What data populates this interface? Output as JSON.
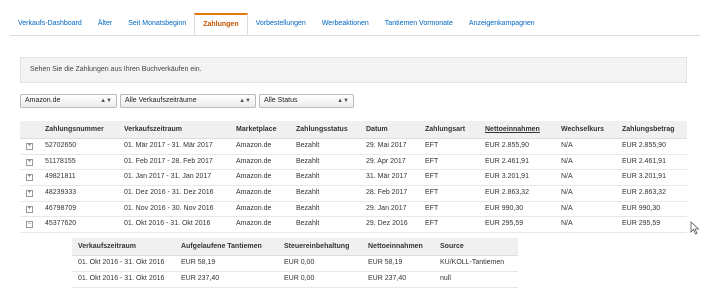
{
  "tabs": [
    {
      "label": "Verkaufs-Dashboard",
      "active": false
    },
    {
      "label": "Älter",
      "active": false
    },
    {
      "label": "Seit Monatsbeginn",
      "active": false
    },
    {
      "label": "Zahlungen",
      "active": true
    },
    {
      "label": "Vorbestellungen",
      "active": false
    },
    {
      "label": "Werbeaktionen",
      "active": false
    },
    {
      "label": "Tantiemen Vormonate",
      "active": false
    },
    {
      "label": "Anzeigenkampagnen",
      "active": false
    }
  ],
  "info_text": "Sehen Sie die Zahlungen aus Ihren Buchverkäufen ein.",
  "filters": {
    "marketplace": "Amazon.de",
    "period": "Alle Verkaufszeiträume",
    "status": "Alle Status"
  },
  "table": {
    "headers": [
      "Zahlungsnummer",
      "Verkaufszeitraum",
      "Marketplace",
      "Zahlungsstatus",
      "Datum",
      "Zahlungsart",
      "Nettoeinnahmen",
      "Wechselkurs",
      "Zahlungsbetrag"
    ],
    "rows": [
      {
        "expander": "+",
        "cells": [
          "52702650",
          "01. Mär 2017 - 31. Mär 2017",
          "Amazon.de",
          "Bezahlt",
          "29. Mai 2017",
          "EFT",
          "EUR 2.855,90",
          "N/A",
          "EUR 2.855,90"
        ]
      },
      {
        "expander": "+",
        "cells": [
          "51178155",
          "01. Feb 2017 - 28. Feb 2017",
          "Amazon.de",
          "Bezahlt",
          "29. Apr 2017",
          "EFT",
          "EUR 2.461,91",
          "N/A",
          "EUR 2.461,91"
        ]
      },
      {
        "expander": "+",
        "cells": [
          "49821811",
          "01. Jan 2017 - 31. Jan 2017",
          "Amazon.de",
          "Bezahlt",
          "31. Mär 2017",
          "EFT",
          "EUR 3.201,91",
          "N/A",
          "EUR 3.201,91"
        ]
      },
      {
        "expander": "+",
        "cells": [
          "48239333",
          "01. Dez 2016 - 31. Dez 2016",
          "Amazon.de",
          "Bezahlt",
          "28. Feb 2017",
          "EFT",
          "EUR 2.863,32",
          "N/A",
          "EUR 2.863,32"
        ]
      },
      {
        "expander": "+",
        "cells": [
          "46798709",
          "01. Nov 2016 - 30. Nov 2016",
          "Amazon.de",
          "Bezahlt",
          "29. Jan 2017",
          "EFT",
          "EUR 990,30",
          "N/A",
          "EUR 990,30"
        ]
      },
      {
        "expander": "−",
        "cells": [
          "45377620",
          "01. Okt 2016 - 31. Okt 2016",
          "Amazon.de",
          "Bezahlt",
          "29. Dez 2016",
          "EFT",
          "EUR 295,59",
          "N/A",
          "EUR 295,59"
        ]
      }
    ]
  },
  "subtable": {
    "headers": [
      "Verkaufszeitraum",
      "Aufgelaufene Tantiemen",
      "Steuereinbehaltung",
      "Nettoeinnahmen",
      "Source"
    ],
    "rows": [
      [
        "01. Okt 2016 - 31. Okt 2016",
        "EUR 58,19",
        "EUR 0,00",
        "EUR 58,19",
        "KU/KOLL-Tantiemen"
      ],
      [
        "01. Okt 2016 - 31. Okt 2016",
        "EUR 237,40",
        "EUR 0,00",
        "EUR 237,40",
        "null"
      ]
    ]
  }
}
